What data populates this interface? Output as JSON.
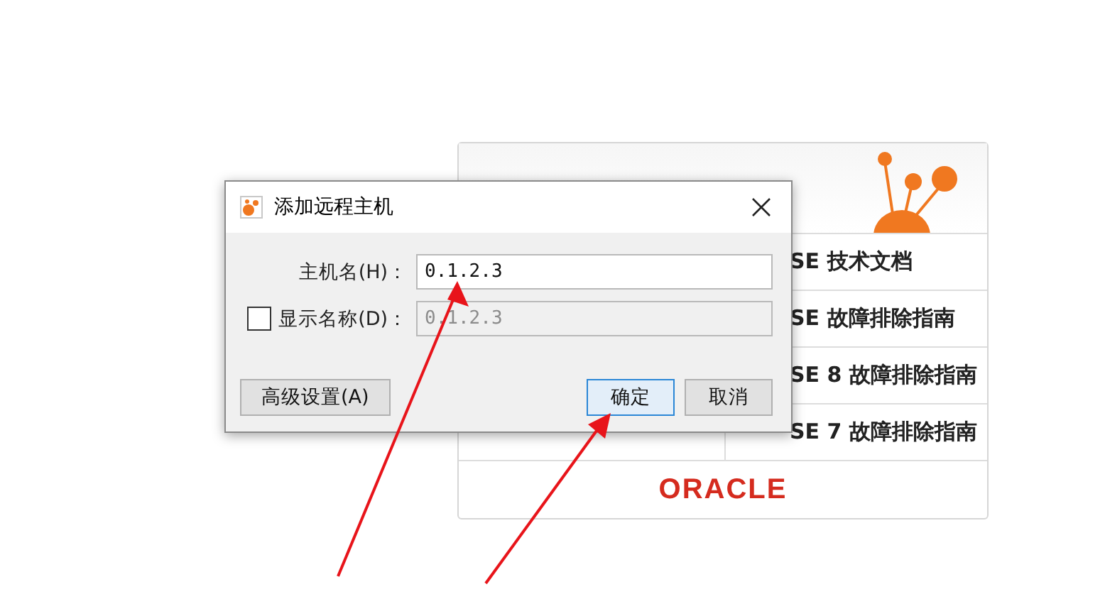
{
  "start_page": {
    "rows": [
      {
        "text": "SE 技术文档"
      },
      {
        "text": "SE 故障排除指南"
      },
      {
        "text": "SE 8 故障排除指南"
      },
      {
        "text": "SE 7 故障排除指南"
      }
    ],
    "footer_logo": "ORACLE"
  },
  "dialog": {
    "title": "添加远程主机",
    "fields": [
      {
        "kind": "text",
        "label": "主机名(H)：",
        "value": "0.1.2.3",
        "disabled": false
      },
      {
        "kind": "checkbox",
        "label": "显示名称(D)：",
        "checked": false,
        "value": "0.1.2.3",
        "disabled": true
      }
    ],
    "buttons": [
      {
        "label": "高级设置(A)",
        "focused": false,
        "kind": "extra"
      },
      {
        "label": "确定",
        "focused": true,
        "kind": "action"
      },
      {
        "label": "取消",
        "focused": false,
        "kind": "action"
      }
    ]
  }
}
